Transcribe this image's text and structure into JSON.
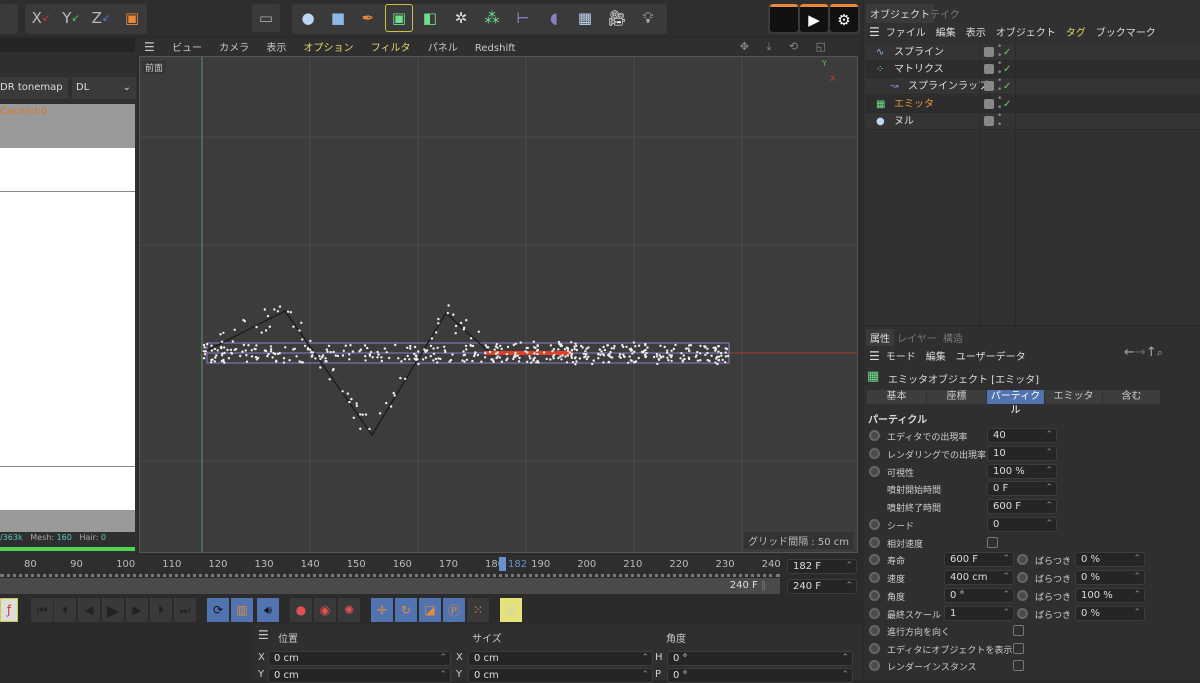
{
  "toolbar": {
    "icons": [
      "x-axis-icon",
      "y-axis-icon",
      "z-axis-icon",
      "world-coordinate-icon",
      "render-region-icon",
      "spline-pen-null-icon",
      "cube-icon",
      "pen-icon",
      "generator-icon",
      "subdivision-icon",
      "mograph-cloner-icon",
      "mograph-icon",
      "deformer-bend-icon",
      "field-icon",
      "floor-icon",
      "camera-icon",
      "light-icon",
      "render-view-icon",
      "render-icon",
      "render-settings-icon"
    ],
    "axis_labels": [
      "X",
      "Y",
      "Z"
    ]
  },
  "left_panel": {
    "tonemap": "DR tonemap",
    "mode": "DL",
    "cached": "Cached:0",
    "stats": {
      "poly": "/363k",
      "mesh_label": "Mesh:",
      "mesh": "160",
      "hair_label": "Hair:",
      "hair": "0"
    }
  },
  "viewport": {
    "menu": [
      "ビュー",
      "カメラ",
      "表示",
      "オプション",
      "フィルタ",
      "パネル",
      "Redshift"
    ],
    "view_name": "前面",
    "grid_spacing": "グリッド間隔 : 50 cm",
    "axis": {
      "x": "X",
      "y": "Y"
    }
  },
  "timeline": {
    "ticks": [
      "80",
      "90",
      "100",
      "110",
      "120",
      "130",
      "140",
      "150",
      "160",
      "170",
      "180",
      "190",
      "200",
      "210",
      "220",
      "230",
      "240"
    ],
    "current": "182",
    "current_field": "182 F",
    "end_field": "240 F",
    "range_end": "240 F"
  },
  "coords": {
    "headers": [
      "位置",
      "サイズ",
      "角度"
    ],
    "rows": [
      {
        "a": "X",
        "av": "0 cm",
        "b": "X",
        "bv": "0 cm",
        "c": "H",
        "cv": "0 °"
      },
      {
        "a": "Y",
        "av": "0 cm",
        "b": "Y",
        "bv": "0 cm",
        "c": "P",
        "cv": "0 °"
      }
    ]
  },
  "objects": {
    "tabs": [
      "オブジェクト",
      "テイク"
    ],
    "menu": [
      "ファイル",
      "編集",
      "表示",
      "オブジェクト",
      "タグ",
      "ブックマーク"
    ],
    "items": [
      {
        "name": "スプライン",
        "icon": "spline-icon",
        "check": true
      },
      {
        "name": "マトリクス",
        "icon": "matrix-icon",
        "check": true
      },
      {
        "name": "スプラインラップ",
        "icon": "spline-wrap-icon",
        "check": true
      },
      {
        "name": "エミッタ",
        "icon": "emitter-icon",
        "check": true,
        "active": true
      },
      {
        "name": "ヌル",
        "icon": "null-icon",
        "check": false
      }
    ]
  },
  "attributes": {
    "tabs": [
      "属性",
      "レイヤー",
      "構造"
    ],
    "menu": [
      "モード",
      "編集",
      "ユーザーデータ"
    ],
    "title": "エミッタオブジェクト [エミッタ]",
    "subtabs": [
      "基本",
      "座標",
      "パーティクル",
      "エミッタ",
      "含む"
    ],
    "active_subtab": "パーティクル",
    "section": "パーティクル",
    "fields": [
      {
        "label": "エディタでの出現率",
        "value": "40"
      },
      {
        "label": "レンダリングでの出現率",
        "value": "10"
      },
      {
        "label": "可視性",
        "value": "100 %"
      },
      {
        "label": "噴射開始時間",
        "value": "0 F"
      },
      {
        "label": "噴射終了時間",
        "value": "600 F"
      },
      {
        "label": "シード",
        "value": "0"
      }
    ],
    "relative_speed": "相対速度",
    "pairs": [
      {
        "label": "寿命",
        "value": "600 F",
        "var_label": "ばらつき",
        "var": "0 %"
      },
      {
        "label": "速度",
        "value": "400 cm",
        "var_label": "ばらつき",
        "var": "0 %"
      },
      {
        "label": "角度",
        "value": "0 °",
        "var_label": "ばらつき",
        "var": "100 %"
      },
      {
        "label": "最終スケール",
        "value": "1",
        "var_label": "ばらつき",
        "var": "0 %"
      }
    ],
    "checks": [
      "進行方向を向く",
      "エディタにオブジェクトを表示",
      "レンダーインスタンス"
    ]
  },
  "colors": {
    "accent": "#5173b0",
    "highlight": "#e3d66a",
    "active_object": "#e89a3a",
    "spline_red": "#e0402a",
    "bbox": "#8b7fd0"
  }
}
